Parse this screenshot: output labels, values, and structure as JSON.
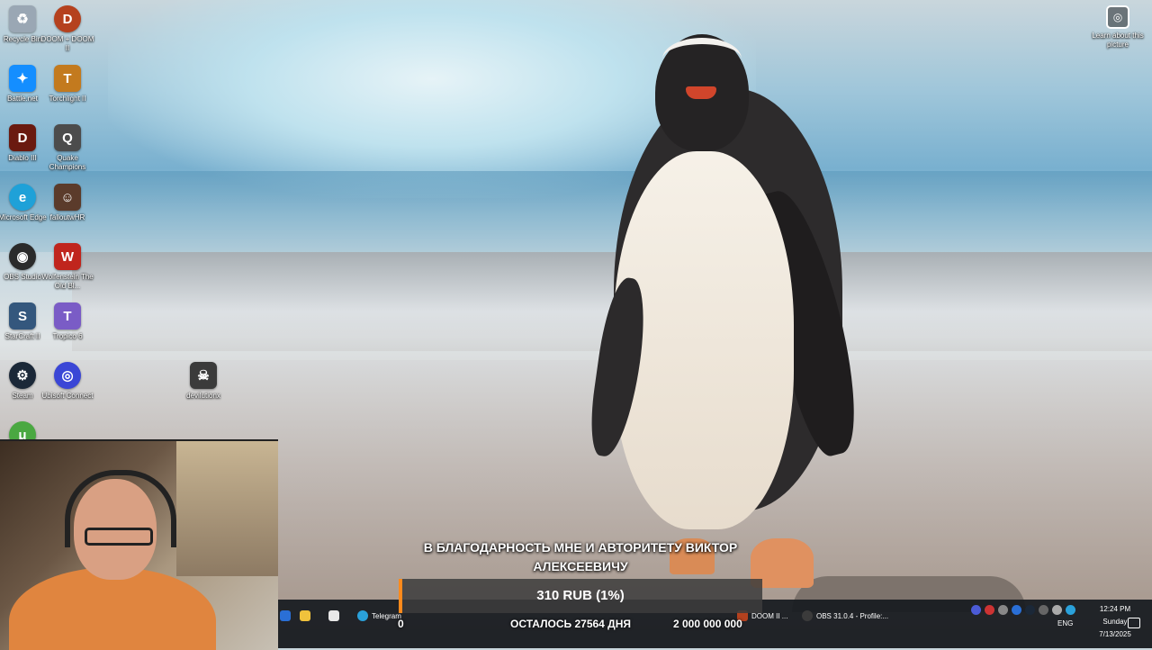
{
  "desktop_icons": [
    {
      "label": "Recycle Bin",
      "icon": "recycle-bin-icon",
      "color": "#9aa7b4",
      "glyph": "♻"
    },
    {
      "label": "DOOM + DOOM II",
      "icon": "doom-icon",
      "color": "#b5411e",
      "glyph": "D"
    },
    {
      "label": "Battle.net",
      "icon": "battle-net-icon",
      "color": "#148eff",
      "glyph": "✦"
    },
    {
      "label": "Torchlight II",
      "icon": "torchlight-icon",
      "color": "#c37a1e",
      "glyph": "T"
    },
    {
      "label": "Diablo III",
      "icon": "diablo-icon",
      "color": "#6a1a10",
      "glyph": "D"
    },
    {
      "label": "Quake Champions",
      "icon": "quake-icon",
      "color": "#4c4c4c",
      "glyph": "Q"
    },
    {
      "label": "Microsoft Edge",
      "icon": "edge-icon",
      "color": "#1fa1d8",
      "glyph": "e"
    },
    {
      "label": "falloutwHR",
      "icon": "fallout-icon",
      "color": "#5b3b2b",
      "glyph": "☺"
    },
    {
      "label": "OBS Studio",
      "icon": "obs-icon",
      "color": "#2b2b2b",
      "glyph": "◉"
    },
    {
      "label": "Wolfenstein The Old Bl...",
      "icon": "wolfenstein-icon",
      "color": "#c0251d",
      "glyph": "W"
    },
    {
      "label": "StarCraft II",
      "icon": "starcraft-icon",
      "color": "#34577d",
      "glyph": "S"
    },
    {
      "label": "Tropico 6",
      "icon": "tropico-icon",
      "color": "#7a5cc6",
      "glyph": "T"
    },
    {
      "label": "Steam",
      "icon": "steam-icon",
      "color": "#1b2838",
      "glyph": "⚙"
    },
    {
      "label": "Ubisoft Connect",
      "icon": "ubisoft-icon",
      "color": "#3a46d6",
      "glyph": "◎"
    },
    {
      "label": "devilutionx",
      "icon": "devilutionx-icon",
      "color": "#3b3b3b",
      "glyph": "☠"
    },
    {
      "label": "",
      "icon": "utorrent-icon",
      "color": "#4aa841",
      "glyph": "μ"
    }
  ],
  "learn_about": {
    "label": "Learn about this picture",
    "icon": "camera-icon"
  },
  "donation": {
    "thanks_line1": "В БЛАГОДАРНОСТЬ МНЕ И АВТОРИТЕТУ ВИКТОР",
    "thanks_line2": "АЛЕКСЕЕВИЧУ",
    "amount": "310 RUB (1%)",
    "progress_percent": 1,
    "start_value": "0",
    "days_left": "ОСТАЛОСЬ 27564 ДНЯ",
    "goal": "2 000 000 000",
    "accent": "#ff8a1c"
  },
  "taskbar": {
    "apps": [
      {
        "label": "Telegram",
        "icon": "telegram-icon",
        "color": "#2aa1da"
      },
      {
        "label": "DOOM II ...",
        "icon": "doom-task-icon",
        "color": "#b5411e"
      },
      {
        "label": "OBS 31.0.4 - Profile:...",
        "icon": "obs-task-icon",
        "color": "#3b3b3b"
      }
    ],
    "language": "ENG",
    "time": "12:24 PM",
    "day": "Sunday",
    "date": "7/13/2025"
  }
}
